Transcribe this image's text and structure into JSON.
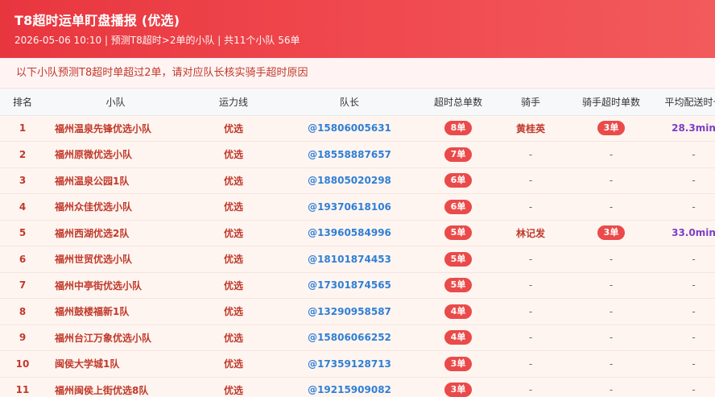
{
  "header": {
    "title": "T8超时运单盯盘播报 (优选)",
    "subtitle": "2026-05-06 10:10 | 预测T8超时>2单的小队 | 共11个小队 56单"
  },
  "notice": "以下小队预测T8超时单超过2单，请对应队长核实骑手超时原因",
  "table": {
    "columns": [
      "排名",
      "小队",
      "运力线",
      "队长",
      "超时总单数",
      "骑手",
      "骑手超时单数",
      "平均配送时长"
    ],
    "rows": [
      {
        "rank": "1",
        "team": "福州温泉先锋优选小队",
        "line": "优选",
        "leader": "@15806005631",
        "total": "8单",
        "rider": "黄桂英",
        "rider_count": "3单",
        "avg": "28.3min"
      },
      {
        "rank": "2",
        "team": "福州原微优选小队",
        "line": "优选",
        "leader": "@18558887657",
        "total": "7单",
        "rider": "-",
        "rider_count": "-",
        "avg": "-"
      },
      {
        "rank": "3",
        "team": "福州温泉公园1队",
        "line": "优选",
        "leader": "@18805020298",
        "total": "6单",
        "rider": "-",
        "rider_count": "-",
        "avg": "-"
      },
      {
        "rank": "4",
        "team": "福州众佳优选小队",
        "line": "优选",
        "leader": "@19370618106",
        "total": "6单",
        "rider": "-",
        "rider_count": "-",
        "avg": "-"
      },
      {
        "rank": "5",
        "team": "福州西湖优选2队",
        "line": "优选",
        "leader": "@13960584996",
        "total": "5单",
        "rider": "林记发",
        "rider_count": "3单",
        "avg": "33.0min"
      },
      {
        "rank": "6",
        "team": "福州世贸优选小队",
        "line": "优选",
        "leader": "@18101874453",
        "total": "5单",
        "rider": "-",
        "rider_count": "-",
        "avg": "-"
      },
      {
        "rank": "7",
        "team": "福州中亭街优选小队",
        "line": "优选",
        "leader": "@17301874565",
        "total": "5单",
        "rider": "-",
        "rider_count": "-",
        "avg": "-"
      },
      {
        "rank": "8",
        "team": "福州鼓楼福新1队",
        "line": "优选",
        "leader": "@13290958587",
        "total": "4单",
        "rider": "-",
        "rider_count": "-",
        "avg": "-"
      },
      {
        "rank": "9",
        "team": "福州台江万象优选小队",
        "line": "优选",
        "leader": "@15806066252",
        "total": "4单",
        "rider": "-",
        "rider_count": "-",
        "avg": "-"
      },
      {
        "rank": "10",
        "team": "闽侯大学城1队",
        "line": "优选",
        "leader": "@17359128713",
        "total": "3单",
        "rider": "-",
        "rider_count": "-",
        "avg": "-"
      },
      {
        "rank": "11",
        "team": "福州闽侯上街优选8队",
        "line": "优选",
        "leader": "@19215909082",
        "total": "3单",
        "rider": "-",
        "rider_count": "-",
        "avg": "-"
      }
    ]
  },
  "colors": {
    "header_start": "#e8363f",
    "header_end": "#f25a5c",
    "accent_red": "#c0392b",
    "badge": "#ea4a4a",
    "leader_blue": "#2f7fd6",
    "avg_purple": "#7b3fc4"
  }
}
